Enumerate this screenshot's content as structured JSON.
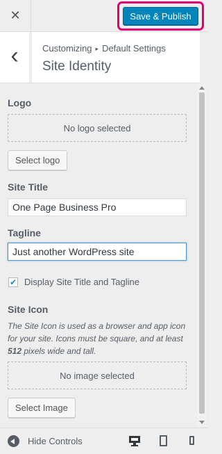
{
  "header": {
    "close_glyph": "✕",
    "publish_label": "Save & Publish",
    "publish_color": "#0085ba",
    "highlight_color": "#e3006f"
  },
  "section": {
    "back_glyph": "‹",
    "breadcrumb": [
      "Customizing",
      "Default Settings"
    ],
    "breadcrumb_sep": "▸",
    "title": "Site Identity"
  },
  "logo": {
    "label": "Logo",
    "placeholder": "No logo selected",
    "button": "Select logo"
  },
  "site_title": {
    "label": "Site Title",
    "value": "One Page Business Pro"
  },
  "tagline": {
    "label": "Tagline",
    "value": "Just another WordPress site"
  },
  "display_title": {
    "label": "Display Site Title and Tagline",
    "checked": true,
    "check_glyph": "✔"
  },
  "site_icon": {
    "label": "Site Icon",
    "description_parts": [
      "The Site Icon is used as a browser and app icon for your site. Icons must be square, and at least ",
      "512",
      " pixels wide and tall."
    ],
    "placeholder": "No image selected",
    "button": "Select Image"
  },
  "footer": {
    "hide_label": "Hide Controls",
    "devices": [
      "desktop-icon",
      "tablet-icon",
      "mobile-icon"
    ]
  }
}
